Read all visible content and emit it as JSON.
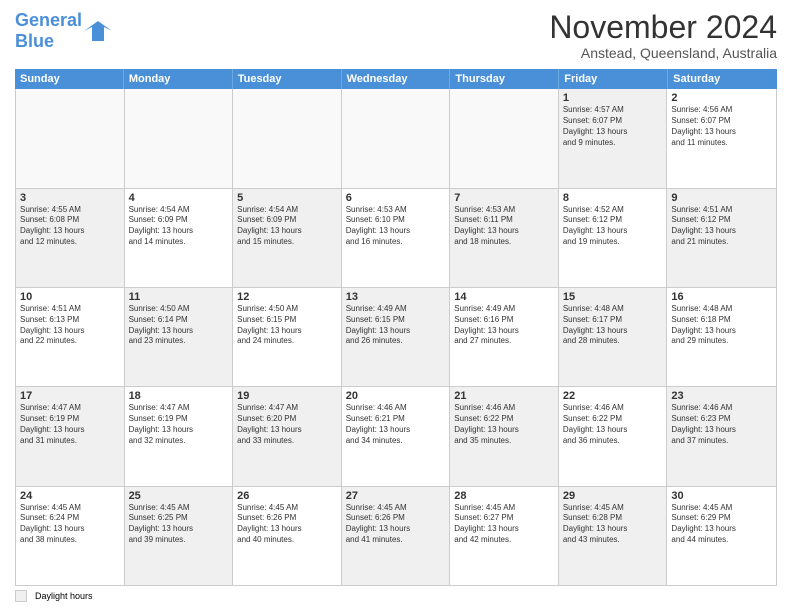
{
  "header": {
    "logo_line1": "General",
    "logo_line2": "Blue",
    "title": "November 2024",
    "subtitle": "Anstead, Queensland, Australia"
  },
  "weekdays": [
    "Sunday",
    "Monday",
    "Tuesday",
    "Wednesday",
    "Thursday",
    "Friday",
    "Saturday"
  ],
  "legend": {
    "box_label": "Daylight hours"
  },
  "weeks": [
    [
      {
        "day": "",
        "info": "",
        "shaded": false,
        "empty": true
      },
      {
        "day": "",
        "info": "",
        "shaded": false,
        "empty": true
      },
      {
        "day": "",
        "info": "",
        "shaded": false,
        "empty": true
      },
      {
        "day": "",
        "info": "",
        "shaded": false,
        "empty": true
      },
      {
        "day": "",
        "info": "",
        "shaded": false,
        "empty": true
      },
      {
        "day": "1",
        "info": "Sunrise: 4:57 AM\nSunset: 6:07 PM\nDaylight: 13 hours\nand 9 minutes.",
        "shaded": true,
        "empty": false
      },
      {
        "day": "2",
        "info": "Sunrise: 4:56 AM\nSunset: 6:07 PM\nDaylight: 13 hours\nand 11 minutes.",
        "shaded": false,
        "empty": false
      }
    ],
    [
      {
        "day": "3",
        "info": "Sunrise: 4:55 AM\nSunset: 6:08 PM\nDaylight: 13 hours\nand 12 minutes.",
        "shaded": true,
        "empty": false
      },
      {
        "day": "4",
        "info": "Sunrise: 4:54 AM\nSunset: 6:09 PM\nDaylight: 13 hours\nand 14 minutes.",
        "shaded": false,
        "empty": false
      },
      {
        "day": "5",
        "info": "Sunrise: 4:54 AM\nSunset: 6:09 PM\nDaylight: 13 hours\nand 15 minutes.",
        "shaded": true,
        "empty": false
      },
      {
        "day": "6",
        "info": "Sunrise: 4:53 AM\nSunset: 6:10 PM\nDaylight: 13 hours\nand 16 minutes.",
        "shaded": false,
        "empty": false
      },
      {
        "day": "7",
        "info": "Sunrise: 4:53 AM\nSunset: 6:11 PM\nDaylight: 13 hours\nand 18 minutes.",
        "shaded": true,
        "empty": false
      },
      {
        "day": "8",
        "info": "Sunrise: 4:52 AM\nSunset: 6:12 PM\nDaylight: 13 hours\nand 19 minutes.",
        "shaded": false,
        "empty": false
      },
      {
        "day": "9",
        "info": "Sunrise: 4:51 AM\nSunset: 6:12 PM\nDaylight: 13 hours\nand 21 minutes.",
        "shaded": true,
        "empty": false
      }
    ],
    [
      {
        "day": "10",
        "info": "Sunrise: 4:51 AM\nSunset: 6:13 PM\nDaylight: 13 hours\nand 22 minutes.",
        "shaded": false,
        "empty": false
      },
      {
        "day": "11",
        "info": "Sunrise: 4:50 AM\nSunset: 6:14 PM\nDaylight: 13 hours\nand 23 minutes.",
        "shaded": true,
        "empty": false
      },
      {
        "day": "12",
        "info": "Sunrise: 4:50 AM\nSunset: 6:15 PM\nDaylight: 13 hours\nand 24 minutes.",
        "shaded": false,
        "empty": false
      },
      {
        "day": "13",
        "info": "Sunrise: 4:49 AM\nSunset: 6:15 PM\nDaylight: 13 hours\nand 26 minutes.",
        "shaded": true,
        "empty": false
      },
      {
        "day": "14",
        "info": "Sunrise: 4:49 AM\nSunset: 6:16 PM\nDaylight: 13 hours\nand 27 minutes.",
        "shaded": false,
        "empty": false
      },
      {
        "day": "15",
        "info": "Sunrise: 4:48 AM\nSunset: 6:17 PM\nDaylight: 13 hours\nand 28 minutes.",
        "shaded": true,
        "empty": false
      },
      {
        "day": "16",
        "info": "Sunrise: 4:48 AM\nSunset: 6:18 PM\nDaylight: 13 hours\nand 29 minutes.",
        "shaded": false,
        "empty": false
      }
    ],
    [
      {
        "day": "17",
        "info": "Sunrise: 4:47 AM\nSunset: 6:19 PM\nDaylight: 13 hours\nand 31 minutes.",
        "shaded": true,
        "empty": false
      },
      {
        "day": "18",
        "info": "Sunrise: 4:47 AM\nSunset: 6:19 PM\nDaylight: 13 hours\nand 32 minutes.",
        "shaded": false,
        "empty": false
      },
      {
        "day": "19",
        "info": "Sunrise: 4:47 AM\nSunset: 6:20 PM\nDaylight: 13 hours\nand 33 minutes.",
        "shaded": true,
        "empty": false
      },
      {
        "day": "20",
        "info": "Sunrise: 4:46 AM\nSunset: 6:21 PM\nDaylight: 13 hours\nand 34 minutes.",
        "shaded": false,
        "empty": false
      },
      {
        "day": "21",
        "info": "Sunrise: 4:46 AM\nSunset: 6:22 PM\nDaylight: 13 hours\nand 35 minutes.",
        "shaded": true,
        "empty": false
      },
      {
        "day": "22",
        "info": "Sunrise: 4:46 AM\nSunset: 6:22 PM\nDaylight: 13 hours\nand 36 minutes.",
        "shaded": false,
        "empty": false
      },
      {
        "day": "23",
        "info": "Sunrise: 4:46 AM\nSunset: 6:23 PM\nDaylight: 13 hours\nand 37 minutes.",
        "shaded": true,
        "empty": false
      }
    ],
    [
      {
        "day": "24",
        "info": "Sunrise: 4:45 AM\nSunset: 6:24 PM\nDaylight: 13 hours\nand 38 minutes.",
        "shaded": false,
        "empty": false
      },
      {
        "day": "25",
        "info": "Sunrise: 4:45 AM\nSunset: 6:25 PM\nDaylight: 13 hours\nand 39 minutes.",
        "shaded": true,
        "empty": false
      },
      {
        "day": "26",
        "info": "Sunrise: 4:45 AM\nSunset: 6:26 PM\nDaylight: 13 hours\nand 40 minutes.",
        "shaded": false,
        "empty": false
      },
      {
        "day": "27",
        "info": "Sunrise: 4:45 AM\nSunset: 6:26 PM\nDaylight: 13 hours\nand 41 minutes.",
        "shaded": true,
        "empty": false
      },
      {
        "day": "28",
        "info": "Sunrise: 4:45 AM\nSunset: 6:27 PM\nDaylight: 13 hours\nand 42 minutes.",
        "shaded": false,
        "empty": false
      },
      {
        "day": "29",
        "info": "Sunrise: 4:45 AM\nSunset: 6:28 PM\nDaylight: 13 hours\nand 43 minutes.",
        "shaded": true,
        "empty": false
      },
      {
        "day": "30",
        "info": "Sunrise: 4:45 AM\nSunset: 6:29 PM\nDaylight: 13 hours\nand 44 minutes.",
        "shaded": false,
        "empty": false
      }
    ]
  ]
}
